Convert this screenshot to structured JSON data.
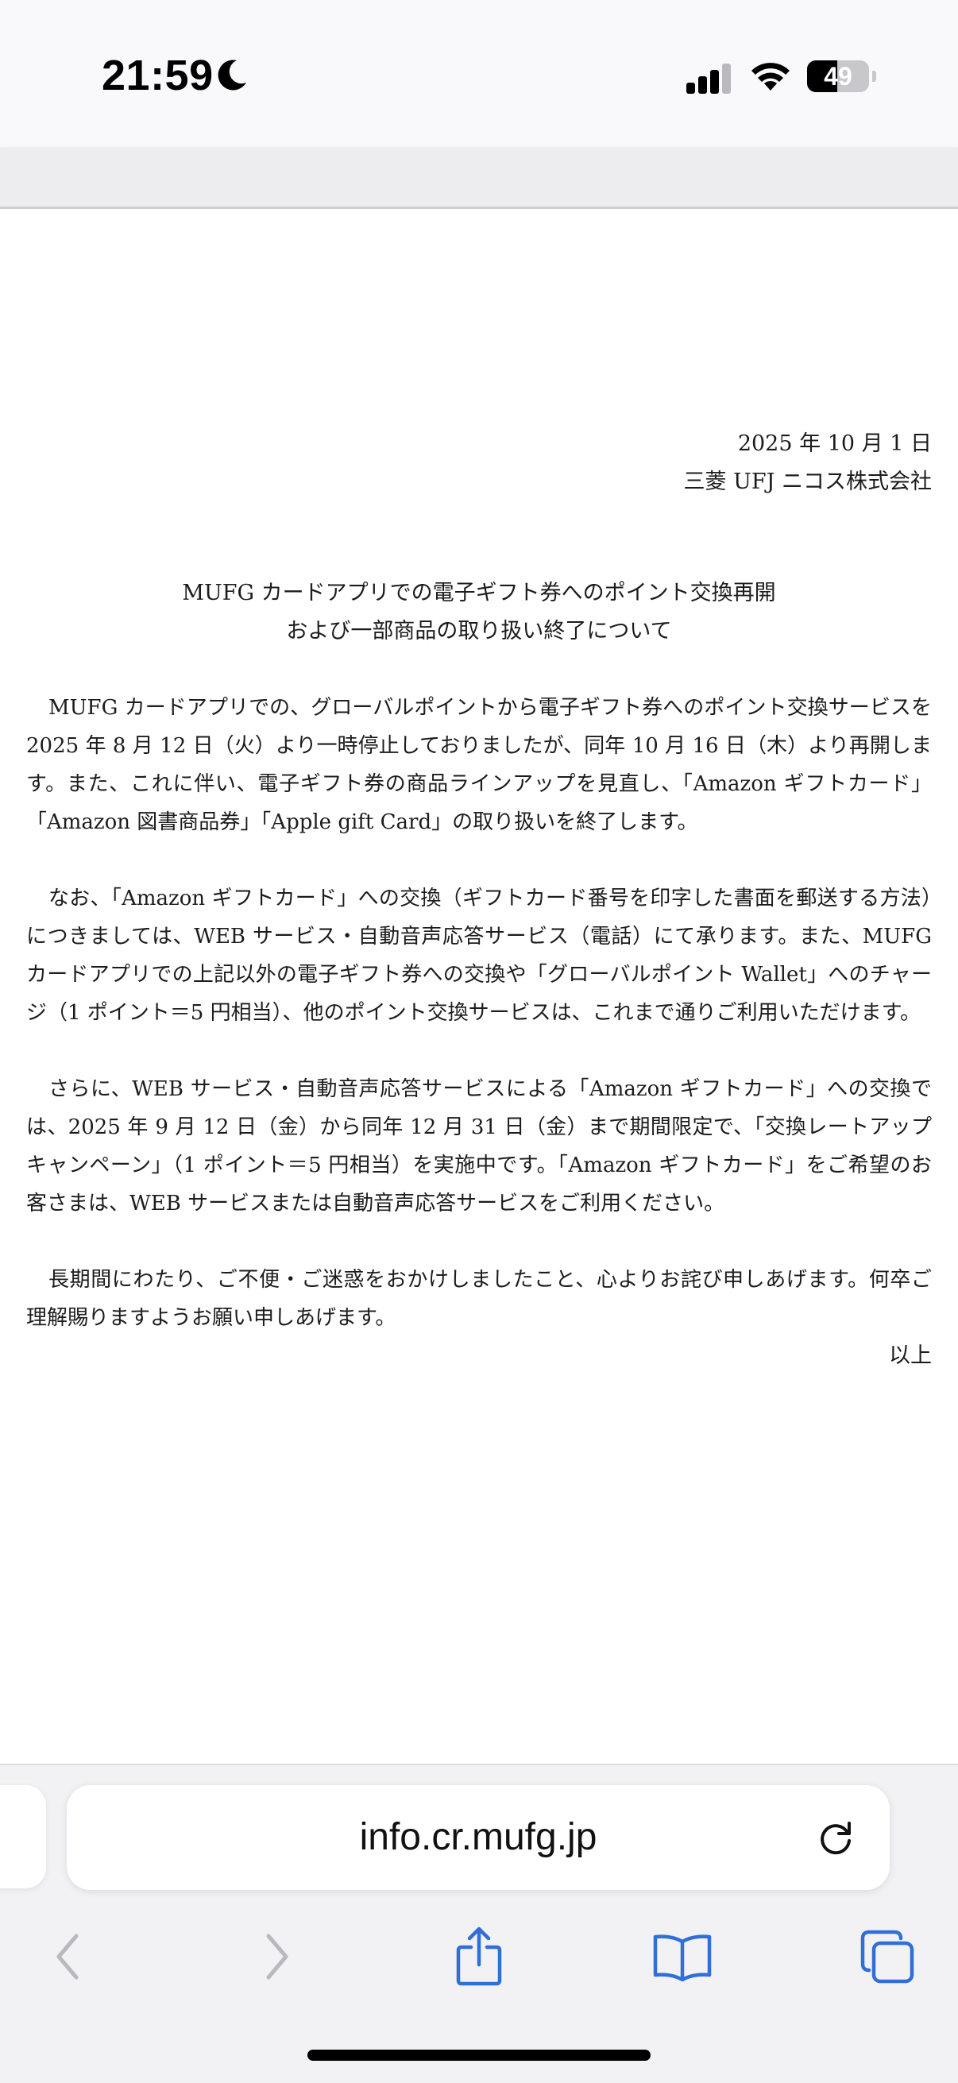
{
  "status_bar": {
    "time": "21:59",
    "battery_level": 49,
    "battery_text": "49",
    "icons": [
      "moon-icon",
      "cellular-signal-icon",
      "wifi-icon",
      "battery-icon"
    ]
  },
  "document": {
    "date": "2025 年 10 月 1 日",
    "issuer": "三菱 UFJ ニコス株式会社",
    "title_line1": "MUFG カードアプリでの電子ギフト券へのポイント交換再開",
    "title_line2": "および一部商品の取り扱い終了について",
    "paragraphs": [
      "MUFG カードアプリでの、グローバルポイントから電子ギフト券へのポイント交換サービスを 2025 年 8 月 12 日（火）より一時停止しておりましたが、同年 10 月 16 日（木）より再開します。また、これに伴い、電子ギフト券の商品ラインアップを見直し、「Amazon ギフトカード」「Amazon 図書商品券」「Apple gift Card」の取り扱いを終了します。",
      "なお、「Amazon ギフトカード」への交換（ギフトカード番号を印字した書面を郵送する方法）につきましては、WEB サービス・自動音声応答サービス（電話）にて承ります。また、MUFG カードアプリでの上記以外の電子ギフト券への交換や「グローバルポイント Wallet」へのチャージ（1 ポイント＝5 円相当）、他のポイント交換サービスは、これまで通りご利用いただけます。",
      "さらに、WEB サービス・自動音声応答サービスによる「Amazon ギフトカード」への交換では、2025 年 9 月 12 日（金）から同年 12 月 31 日（金）まで期間限定で、「交換レートアップキャンペーン」（1 ポイント＝5 円相当）を実施中です。「Amazon ギフトカード」をご希望のお客さまは、WEB サービスまたは自動音声応答サービスをご利用ください。",
      "長期間にわたり、ご不便・ご迷惑をおかけしましたこと、心よりお詫び申しあげます。何卒ご理解賜りますようお願い申しあげます。"
    ],
    "closing": "以上"
  },
  "browser": {
    "url": "info.cr.mufg.jp",
    "accent_color": "#2f6fd6",
    "disabled_color": "#b8b8bd",
    "toolbar": [
      "back-icon",
      "forward-icon",
      "share-icon",
      "bookmarks-icon",
      "tabs-icon"
    ]
  }
}
